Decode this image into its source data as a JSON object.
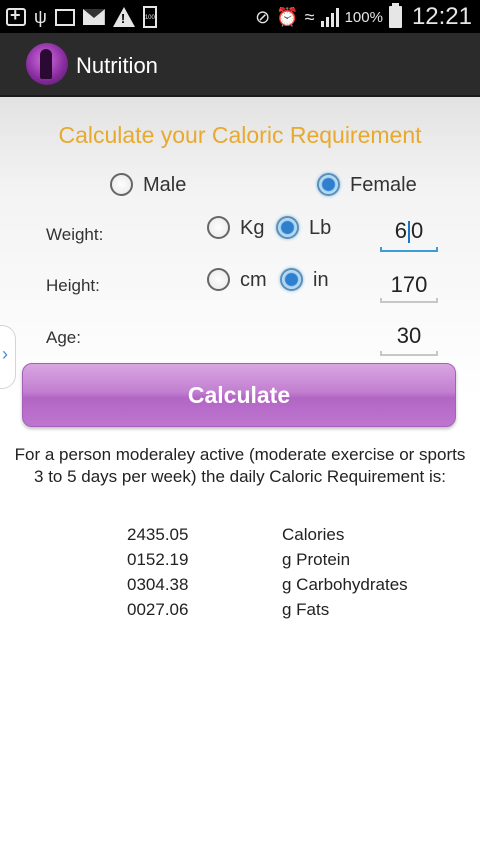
{
  "status_bar": {
    "battery_percent": "100%",
    "time": "12:21",
    "small_battery_label": "100",
    "icons": [
      "plus-box-icon",
      "usb-icon",
      "image-icon",
      "mail-icon",
      "warning-icon",
      "battery-small-icon",
      "mute-icon",
      "alarm-icon",
      "wifi-icon",
      "signal-icon",
      "battery-icon"
    ]
  },
  "action_bar": {
    "title": "Nutrition"
  },
  "main": {
    "heading": "Calculate your Caloric Requirement",
    "gender": {
      "options": [
        "Male",
        "Female"
      ],
      "selected": "Female"
    },
    "weight": {
      "label": "Weight:",
      "units": [
        "Kg",
        "Lb"
      ],
      "selected_unit": "Lb",
      "value_before_cursor": "6",
      "value_after_cursor": "0"
    },
    "height": {
      "label": "Height:",
      "units": [
        "cm",
        "in"
      ],
      "selected_unit": "in",
      "value": "170"
    },
    "age": {
      "label": "Age:",
      "value": "30"
    },
    "calculate_label": "Calculate",
    "description": "For a person moderaley active (moderate exercise or sports 3 to 5 days per week) the daily Caloric Requirement is:",
    "results": [
      {
        "value": "2435.05",
        "unit": "Calories"
      },
      {
        "value": "0152.19",
        "unit": "g Protein"
      },
      {
        "value": "0304.38",
        "unit": "g Carbohydrates"
      },
      {
        "value": "0027.06",
        "unit": "g Fats"
      }
    ]
  },
  "colors": {
    "heading": "#e8a92c",
    "button": "#c27fd0",
    "radio_selected": "#2f7fcf",
    "action_bar": "#2b2b2b"
  }
}
